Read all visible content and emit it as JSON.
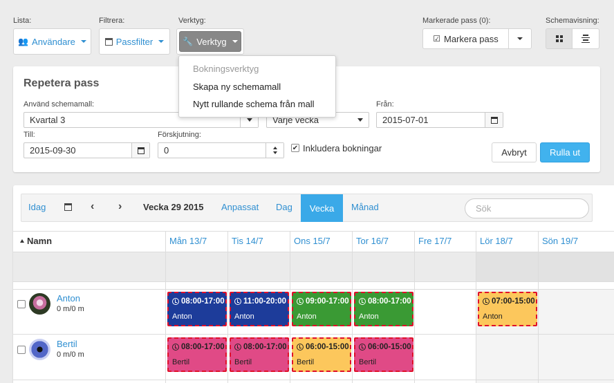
{
  "top": {
    "lista_label": "Lista:",
    "lista_button": "Användare",
    "filtrera_label": "Filtrera:",
    "filtrera_button": "Passfilter",
    "verktyg_label": "Verktyg:",
    "verktyg_button": "Verktyg",
    "markerade_label": "Markerade pass (0):",
    "markera_button": "Markera pass",
    "schemavisning_label": "Schemavisning:"
  },
  "dropdown": {
    "header": "Bokningsverktyg",
    "items": [
      "Skapa ny schemamall",
      "Nytt rullande schema från mall"
    ]
  },
  "repeat": {
    "title": "Repetera pass",
    "template_label": "Använd schemamall:",
    "template_value": "Kvartal 3",
    "interval_value": "Varje vecka",
    "from_label": "Från:",
    "from_value": "2015-07-01",
    "to_label": "Till:",
    "to_value": "2015-09-30",
    "offset_label": "Förskjutning:",
    "offset_value": "0",
    "include_label": "Inkludera bokningar",
    "cancel": "Avbryt",
    "submit": "Rulla ut"
  },
  "calendar": {
    "today": "Idag",
    "week_label": "Vecka 29 2015",
    "views": [
      "Anpassat",
      "Dag",
      "Vecka",
      "Månad"
    ],
    "active_view": "Vecka",
    "search_placeholder": "Sök",
    "name_header": "Namn",
    "days": [
      "Mån 13/7",
      "Tis 14/7",
      "Ons 15/7",
      "Tor 16/7",
      "Fre 17/7",
      "Lör 18/7",
      "Sön 19/7"
    ],
    "people": [
      {
        "name": "Anton",
        "sub": "0 m/0 m",
        "shifts": [
          {
            "day": 0,
            "time": "08:00-17:00",
            "who": "Anton",
            "color": "blue"
          },
          {
            "day": 1,
            "time": "11:00-20:00",
            "who": "Anton",
            "color": "blue"
          },
          {
            "day": 2,
            "time": "09:00-17:00",
            "who": "Anton",
            "color": "green"
          },
          {
            "day": 3,
            "time": "08:00-17:00",
            "who": "Anton",
            "color": "green"
          },
          {
            "day": 5,
            "time": "07:00-15:00",
            "who": "Anton",
            "color": "yellow"
          }
        ]
      },
      {
        "name": "Bertil",
        "sub": "0 m/0 m",
        "shifts": [
          {
            "day": 0,
            "time": "08:00-17:00",
            "who": "Bertil",
            "color": "pink"
          },
          {
            "day": 1,
            "time": "08:00-17:00",
            "who": "Bertil",
            "color": "pink"
          },
          {
            "day": 2,
            "time": "06:00-15:00",
            "who": "Bertil",
            "color": "yellow"
          },
          {
            "day": 3,
            "time": "06:00-15:00",
            "who": "Bertil",
            "color": "pink"
          }
        ]
      }
    ]
  },
  "colors": {
    "accent": "#2f8fd1",
    "active_tab": "#3aa9e8",
    "shift_border": "#e0102a"
  }
}
